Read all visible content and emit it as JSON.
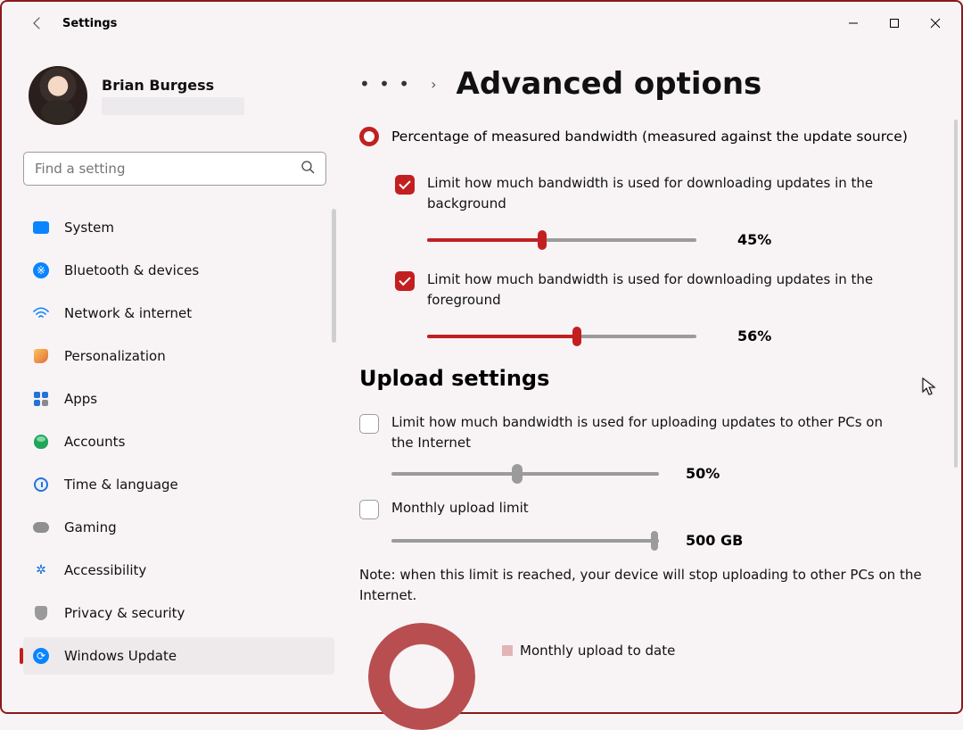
{
  "window": {
    "title": "Settings",
    "user_name": "Brian Burgess",
    "search_placeholder": "Find a setting"
  },
  "sidebar": {
    "items": [
      {
        "label": "System"
      },
      {
        "label": "Bluetooth & devices"
      },
      {
        "label": "Network & internet"
      },
      {
        "label": "Personalization"
      },
      {
        "label": "Apps"
      },
      {
        "label": "Accounts"
      },
      {
        "label": "Time & language"
      },
      {
        "label": "Gaming"
      },
      {
        "label": "Accessibility"
      },
      {
        "label": "Privacy & security"
      },
      {
        "label": "Windows Update"
      }
    ]
  },
  "breadcrumb": {
    "title": "Advanced options"
  },
  "download": {
    "radio_label": "Percentage of measured bandwidth (measured against the update source)",
    "bg_check_label": "Limit how much bandwidth is used for downloading updates in the background",
    "bg_pct": "45%",
    "fg_check_label": "Limit how much bandwidth is used for downloading updates in the foreground",
    "fg_pct": "56%"
  },
  "upload": {
    "heading": "Upload settings",
    "bw_check_label": "Limit how much bandwidth is used for uploading updates to other PCs on the Internet",
    "bw_pct": "50%",
    "monthly_check_label": "Monthly upload limit",
    "monthly_value": "500 GB",
    "note": "Note: when this limit is reached, your device will stop uploading to other PCs on the Internet.",
    "legend_label": "Monthly upload to date"
  }
}
